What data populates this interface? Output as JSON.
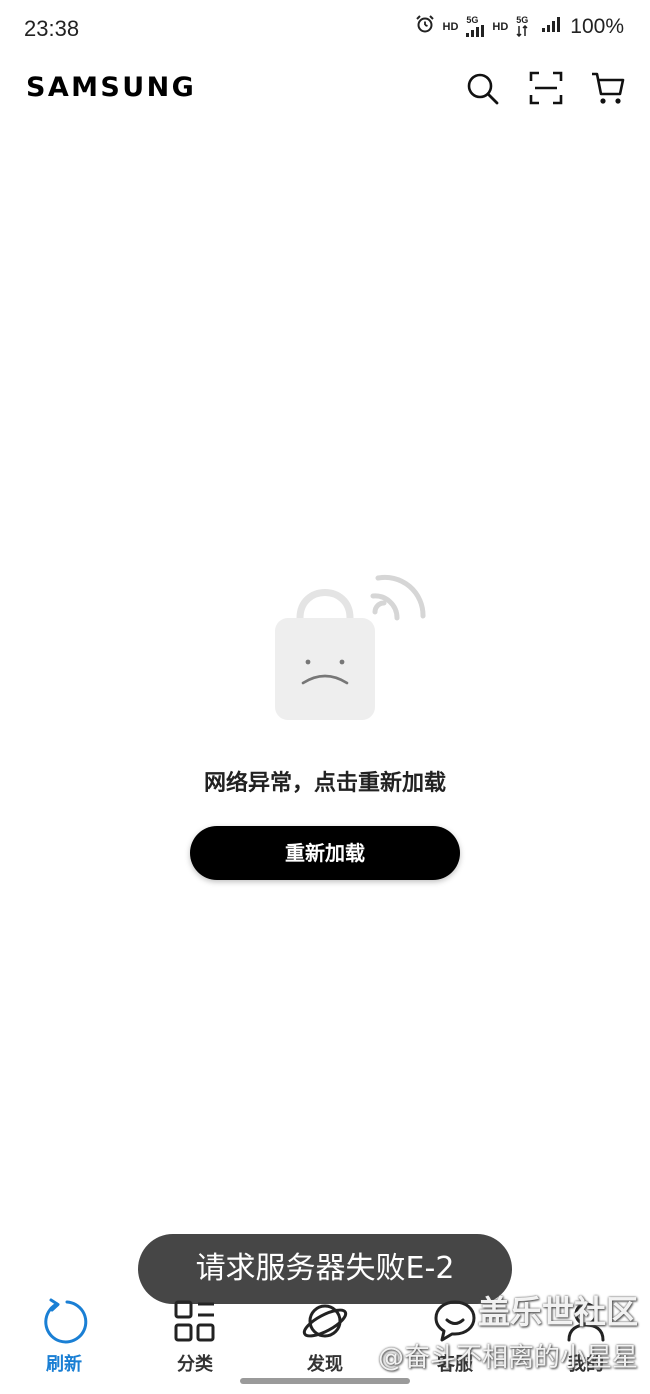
{
  "status_bar": {
    "time": "23:38",
    "hd1": "HD",
    "net1": "5G",
    "hd2": "HD",
    "net2": "5G",
    "battery": "100%"
  },
  "header": {
    "brand": "SAMSUNG",
    "icons": [
      "search-icon",
      "scan-icon",
      "cart-icon"
    ]
  },
  "error": {
    "message": "网络异常，点击重新加载",
    "button_label": "重新加载"
  },
  "toast": "请求服务器失败E-2",
  "bottom_nav": {
    "active_color": "#1a7fd4",
    "items": [
      {
        "label": "刷新",
        "icon": "refresh-icon",
        "active": true
      },
      {
        "label": "分类",
        "icon": "category-icon",
        "active": false
      },
      {
        "label": "发现",
        "icon": "planet-icon",
        "active": false
      },
      {
        "label": "客服",
        "icon": "chat-icon",
        "active": false
      },
      {
        "label": "我的",
        "icon": "user-icon",
        "active": false
      }
    ]
  },
  "watermark": {
    "title": "盖乐世社区",
    "author": "@奋斗不相离的小星星"
  }
}
